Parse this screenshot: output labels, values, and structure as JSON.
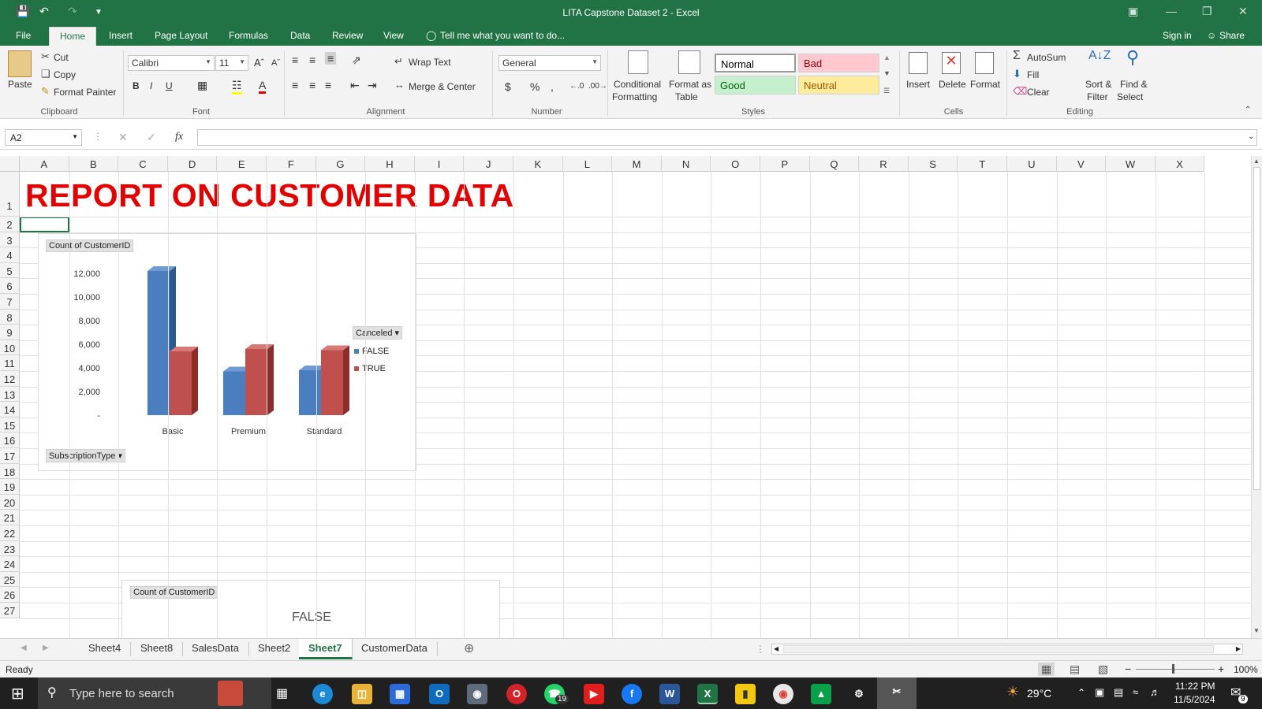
{
  "window": {
    "title": "LITA Capstone Dataset 2 - Excel"
  },
  "ribbon_tabs": [
    "File",
    "Home",
    "Insert",
    "Page Layout",
    "Formulas",
    "Data",
    "Review",
    "View"
  ],
  "tell_me": "Tell me what you want to do...",
  "sign_in": "Sign in",
  "share": "Share",
  "clipboard": {
    "paste": "Paste",
    "cut": "Cut",
    "copy": "Copy",
    "format_painter": "Format Painter",
    "label": "Clipboard"
  },
  "font": {
    "name": "Calibri",
    "size": "11",
    "label": "Font"
  },
  "alignment": {
    "wrap_text": "Wrap Text",
    "merge_center": "Merge & Center",
    "label": "Alignment"
  },
  "number": {
    "format": "General",
    "label": "Number"
  },
  "styles": {
    "conditional": [
      "Conditional",
      "Formatting"
    ],
    "format_table": [
      "Format as",
      "Table"
    ],
    "normal": "Normal",
    "bad": "Bad",
    "good": "Good",
    "neutral": "Neutral",
    "label": "Styles"
  },
  "cells": {
    "insert": "Insert",
    "delete": "Delete",
    "format": "Format",
    "label": "Cells"
  },
  "editing": {
    "autosum": "AutoSum",
    "fill": "Fill",
    "clear": "Clear",
    "sort": [
      "Sort &",
      "Filter"
    ],
    "find": [
      "Find &",
      "Select"
    ],
    "label": "Editing"
  },
  "formula_bar": {
    "name_box": "A2",
    "formula": ""
  },
  "columns": [
    "A",
    "B",
    "C",
    "D",
    "E",
    "F",
    "G",
    "H",
    "I",
    "J",
    "K",
    "L",
    "M",
    "N",
    "O",
    "P",
    "Q",
    "R",
    "S",
    "T",
    "U",
    "V",
    "W",
    "X"
  ],
  "rows": [
    "1",
    "2",
    "3",
    "4",
    "5",
    "6",
    "7",
    "8",
    "9",
    "10",
    "11",
    "12",
    "13",
    "14",
    "15",
    "16",
    "17",
    "18",
    "19",
    "20",
    "21",
    "22",
    "23",
    "24",
    "25",
    "26",
    "27"
  ],
  "report_title": "REPORT ON CUSTOMER DATA",
  "chart_data": {
    "type": "bar",
    "value_field": "Count of CustomerID",
    "legend_field": "Canceled",
    "axis_field": "SubscriptionType",
    "categories": [
      "Basic",
      "Premium",
      "Standard"
    ],
    "series": [
      {
        "name": "FALSE",
        "color": "#4a7ebf",
        "values": [
          12200,
          3700,
          3800
        ]
      },
      {
        "name": "TRUE",
        "color": "#c0504d",
        "values": [
          5400,
          5600,
          5500
        ]
      }
    ],
    "y_ticks": [
      "-",
      "2,000",
      "4,000",
      "6,000",
      "8,000",
      "10,000",
      "12,000"
    ],
    "ylim": [
      0,
      12000
    ],
    "legend_position": "right"
  },
  "chart2": {
    "value_field": "Count of CustomerID",
    "title": "FALSE"
  },
  "sheet_tabs": [
    "Sheet4",
    "Sheet8",
    "SalesData",
    "Sheet2",
    "Sheet7",
    "CustomerData"
  ],
  "active_sheet": "Sheet7",
  "status": {
    "ready": "Ready",
    "zoom": "100%"
  },
  "taskbar": {
    "search": "Type here to search",
    "weather": "29°C",
    "time": "11:22 PM",
    "date": "11/5/2024",
    "whatsapp_badge": "19",
    "notif_badge": "9"
  }
}
